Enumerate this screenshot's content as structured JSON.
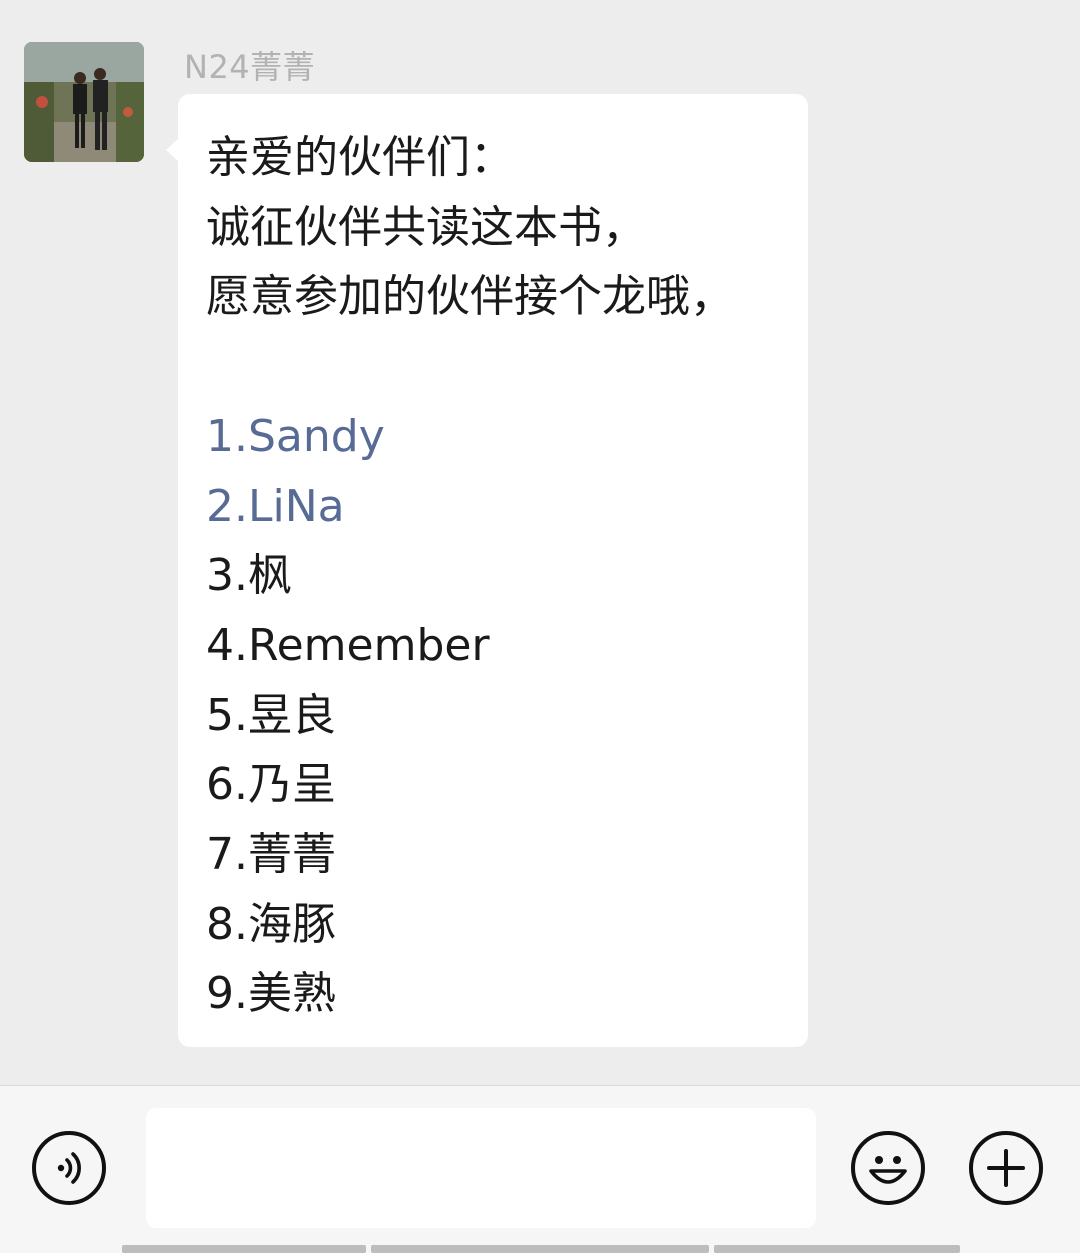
{
  "chat": {
    "sender_name": "N24菁菁",
    "message_lines": [
      {
        "text": "亲爱的伙伴们：",
        "linked": false
      },
      {
        "text": "诚征伙伴共读这本书，",
        "linked": false
      },
      {
        "text": "愿意参加的伙伴接个龙哦，",
        "linked": false
      },
      {
        "text": "",
        "linked": false
      },
      {
        "text": "1.Sandy",
        "linked": true
      },
      {
        "text": "2.LiNa",
        "linked": true
      },
      {
        "text": "3.枫",
        "linked": false
      },
      {
        "text": "4.Remember",
        "linked": false
      },
      {
        "text": "5.昱良",
        "linked": false
      },
      {
        "text": "6.乃呈",
        "linked": false
      },
      {
        "text": "7.菁菁",
        "linked": false
      },
      {
        "text": "8.海豚",
        "linked": false
      },
      {
        "text": "9.美熟",
        "linked": false
      }
    ],
    "link_color": "#576b95",
    "text_color": "#1a1a1a"
  },
  "input_bar": {
    "voice_icon": "voice-icon",
    "emoji_icon": "emoji-icon",
    "plus_icon": "plus-icon",
    "input_value": ""
  }
}
